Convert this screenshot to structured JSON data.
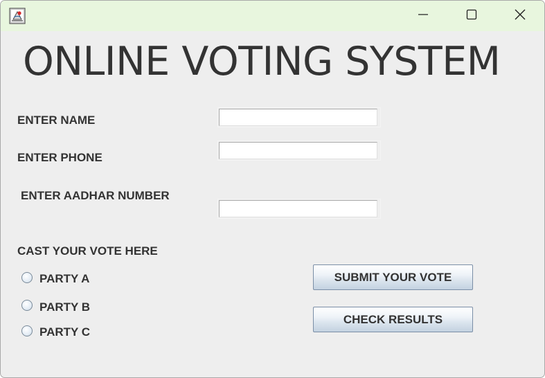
{
  "window": {
    "title_icon": "java-app-icon",
    "controls": {
      "minimize": "minimize-icon",
      "maximize": "maximize-icon",
      "close": "close-icon"
    }
  },
  "header": {
    "title": "ONLINE VOTING SYSTEM"
  },
  "form": {
    "name_label": "ENTER NAME",
    "name_value": "",
    "phone_label": "ENTER PHONE",
    "phone_value": "",
    "aadhar_label": "ENTER AADHAR NUMBER",
    "aadhar_value": ""
  },
  "vote": {
    "heading": "CAST YOUR VOTE HERE",
    "options": [
      {
        "label": "PARTY A",
        "selected": false
      },
      {
        "label": "PARTY B",
        "selected": false
      },
      {
        "label": "PARTY C",
        "selected": false
      }
    ]
  },
  "actions": {
    "submit_label": "SUBMIT YOUR VOTE",
    "results_label": "CHECK RESULTS"
  },
  "colors": {
    "titlebar": "#e8f6de",
    "window_bg": "#eeeeee",
    "text": "#333333"
  }
}
